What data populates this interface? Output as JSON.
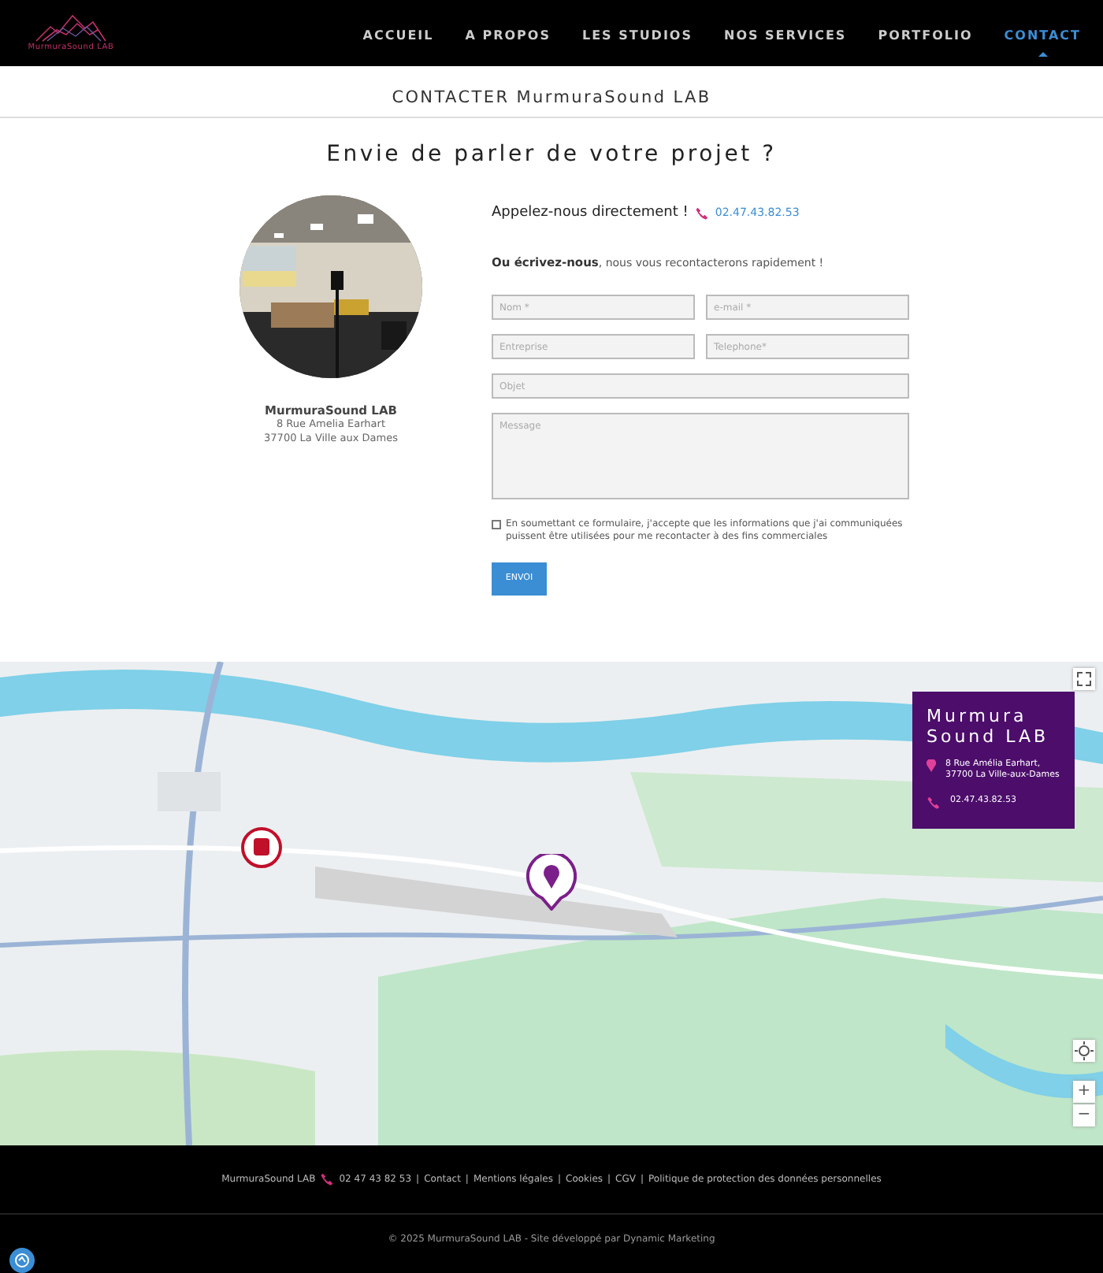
{
  "header": {
    "logo_text": "MurmuraSound LAB",
    "nav": [
      {
        "label": "ACCUEIL",
        "selected": false
      },
      {
        "label": "A PROPOS",
        "selected": false
      },
      {
        "label": "LES STUDIOS",
        "selected": false
      },
      {
        "label": "NOS SERVICES",
        "selected": false
      },
      {
        "label": "PORTFOLIO",
        "selected": false
      },
      {
        "label": "CONTACT",
        "selected": true
      }
    ]
  },
  "page_title": "CONTACTER MurmuraSound LAB",
  "heading": "Envie de parler de votre projet ?",
  "studio": {
    "name": "MurmuraSound LAB",
    "address_lines": [
      "8 Rue Amelia Earhart",
      "37700 La Ville aux Dames"
    ]
  },
  "contact_form": {
    "call_label": "Appelez-nous directement !",
    "phone": "02.47.43.82.53",
    "write_label": "Ou écrivez-nous",
    "write_note": ", nous vous recontacterons rapidement !",
    "fields": [
      {
        "placeholder": "Nom *",
        "kind": "half"
      },
      {
        "placeholder": "e-mail *",
        "kind": "half"
      },
      {
        "placeholder": "Entreprise",
        "kind": "half"
      },
      {
        "placeholder": "Telephone*",
        "kind": "half"
      },
      {
        "placeholder": "Objet",
        "kind": "full"
      },
      {
        "placeholder": "Message",
        "kind": "area"
      }
    ],
    "consent": {
      "checked": false,
      "text": "En soumettant ce formulaire, j'accepte que les informations que j'ai communiquées puissent être utilisées pour me recontacter à des fins commerciales"
    },
    "submit": "ENVOI"
  },
  "map": {
    "card": {
      "title_lines": [
        "Murmura",
        "Sound LAB"
      ],
      "address": "8 Rue Amélia Earhart, 37700 La Ville-aux-Dames",
      "phone": "02.47.43.82.53"
    },
    "zoom_in": "+",
    "zoom_out": "−"
  },
  "footer": {
    "brand": "MurmuraSound LAB",
    "phone": "02 47 43 82 53",
    "separator": "|",
    "links": [
      "Contact",
      "Mentions légales",
      "Cookies",
      "CGV",
      "Politique de protection des données personnelles"
    ],
    "copyright": "© 2025 MurmuraSound LAB - Site développé par Dynamic Marketing"
  }
}
